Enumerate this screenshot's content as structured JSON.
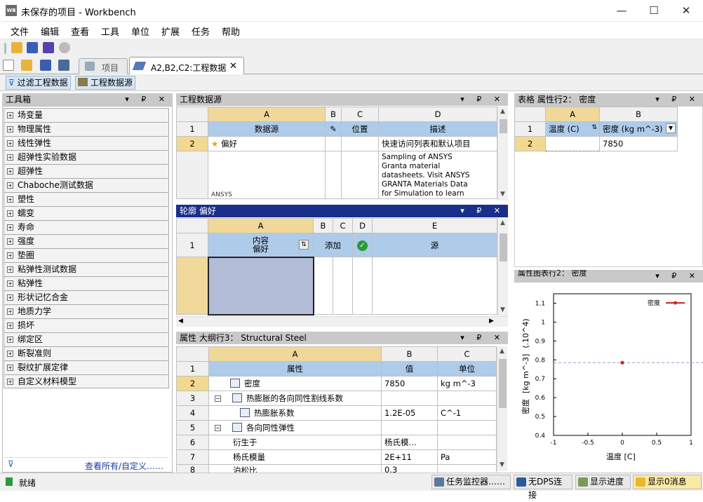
{
  "window": {
    "title": "未保存的项目 - Workbench",
    "app_icon": "WB",
    "minimize": "—",
    "maximize": "☐",
    "close": "✕"
  },
  "menu": [
    "文件",
    "编辑",
    "查看",
    "工具",
    "单位",
    "扩展",
    "任务",
    "帮助"
  ],
  "tabs": {
    "project": "项目",
    "engineering": "A2,B2,C2:工程数据",
    "close": "✕"
  },
  "toolbar2": {
    "filter": "过滤工程数据",
    "source": "工程数据源"
  },
  "toolbox": {
    "title": "工具箱",
    "items": [
      "场变量",
      "物理属性",
      "线性弹性",
      "超弹性实验数据",
      "超弹性",
      "Chaboche测试数据",
      "塑性",
      "蠕变",
      "寿命",
      "强度",
      "垫圈",
      "粘弹性测试数据",
      "粘弹性",
      "形状记忆合金",
      "地质力学",
      "损坏",
      "绑定区",
      "断裂准则",
      "裂纹扩展定律",
      "自定义材料模型"
    ],
    "footer_link": "查看所有/自定义……"
  },
  "panel_buttons": "▾ ₽ ✕",
  "eng_source": {
    "title": "工程数据源",
    "cols": [
      "A",
      "B",
      "C",
      "D"
    ],
    "row_nums": [
      "1",
      "2"
    ],
    "headers": {
      "a": "数据源",
      "c": "位置",
      "d": "描述"
    },
    "row2": {
      "a": "偏好",
      "d": "快速访问列表和默认项目"
    },
    "row3": {
      "a": "ANSYS",
      "d1": "Sampling of ANSYS",
      "d2": "Granta material",
      "d3": "datasheets. Visit ANSYS",
      "d4": "GRANTA Materials Data",
      "d5": "for Simulation to learn"
    }
  },
  "outline": {
    "title": "轮廓 偏好",
    "cols": [
      "A",
      "B",
      "C",
      "D",
      "E"
    ],
    "row_num": "1",
    "headers": {
      "a1": "内容",
      "a2": "偏好",
      "b": "添加",
      "e": "源"
    }
  },
  "props": {
    "title": "属性 大纲行3： Structural Steel",
    "cols": [
      "A",
      "B",
      "C"
    ],
    "headers": {
      "a": "属性",
      "b": "值",
      "c": "单位"
    },
    "rows": [
      {
        "n": "2",
        "a": "密度",
        "b": "7850",
        "c": "kg m^-3"
      },
      {
        "n": "3",
        "a": "热膨胀的各向同性割线系数",
        "b": "",
        "c": ""
      },
      {
        "n": "4",
        "a": "热膨胀系数",
        "b": "1.2E-05",
        "c": "C^-1"
      },
      {
        "n": "5",
        "a": "各向同性弹性",
        "b": "",
        "c": ""
      },
      {
        "n": "6",
        "a": "衍生于",
        "b": "杨氏模…",
        "c": ""
      },
      {
        "n": "7",
        "a": "杨氏模量",
        "b": "2E+11",
        "c": "Pa"
      },
      {
        "n": "8",
        "a": "泊松比",
        "b": "0.3",
        "c": ""
      }
    ]
  },
  "table_panel": {
    "title": "表格 属性行2： 密度",
    "cols": [
      "A",
      "B"
    ],
    "row_nums": [
      "1",
      "2"
    ],
    "headers": {
      "a": "温度 (C)",
      "b": "密度 (kg m^-3)"
    },
    "row2": {
      "a": "",
      "b": "7850"
    }
  },
  "chart_panel": {
    "title": "属性图表行2： 密度"
  },
  "chart_data": {
    "type": "scatter",
    "title": "",
    "xlabel": "温度  [C]",
    "ylabel": "密度  [kg m^-3]  (.10^4)",
    "ylabel_parts": {
      "a": "密度",
      "b": "[kg m^-3]",
      "c": "(.10^4)"
    },
    "x_ticks": [
      "-1",
      "-0.5",
      "0",
      "0.5",
      "1"
    ],
    "y_ticks": [
      "0.4",
      "0.5",
      "0.6",
      "0.7",
      "0.8",
      "0.9",
      "1",
      "1.1"
    ],
    "xlim": [
      -1,
      1
    ],
    "ylim": [
      0.4,
      1.15
    ],
    "series": [
      {
        "name": "密度",
        "x": [
          0
        ],
        "y": [
          0.785
        ],
        "color": "#cc2222"
      }
    ],
    "reference_line_y": 0.785,
    "legend": "top-right"
  },
  "status": {
    "text": "就绪",
    "buttons": [
      "任务监控器……",
      "无DPS连接",
      "显示进度",
      "显示0消息"
    ]
  },
  "colors": {
    "accent": "#1a2f8a",
    "header_blue": "#aecbea",
    "col_header": "#efd89a"
  }
}
